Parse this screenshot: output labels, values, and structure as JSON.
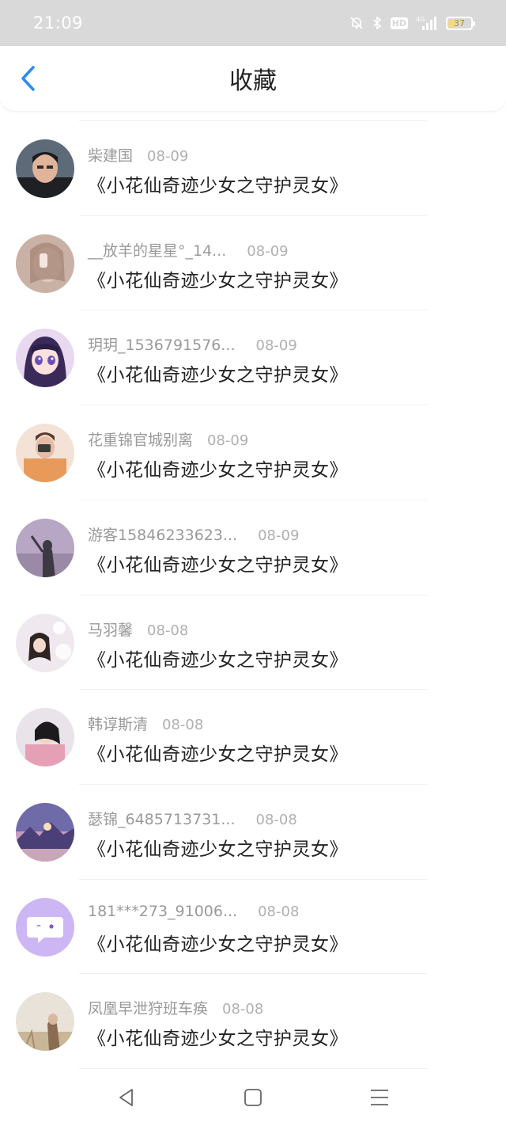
{
  "status_bar": {
    "time": "21:09",
    "network": "4G",
    "battery": "37",
    "battery_level": 0.37
  },
  "header": {
    "title": "收藏",
    "accent_color": "#2a8cf0"
  },
  "favorites": [
    {
      "user": "柴建国",
      "date": "08-09",
      "book": "《小花仙奇迹少女之守护灵女》",
      "avatar": "boy-photo"
    },
    {
      "user": "__放羊的星星°_14...",
      "date": "08-09",
      "book": "《小花仙奇迹少女之守护灵女》",
      "avatar": "girl-selfie"
    },
    {
      "user": "玥玥_1536791576...",
      "date": "08-09",
      "book": "《小花仙奇迹少女之守护灵女》",
      "avatar": "anime-girl"
    },
    {
      "user": "花重锦官城别离",
      "date": "08-09",
      "book": "《小花仙奇迹少女之守护灵女》",
      "avatar": "girl-camera"
    },
    {
      "user": "游客15846233623...",
      "date": "08-09",
      "book": "《小花仙奇迹少女之守护灵女》",
      "avatar": "sunset-silhouette"
    },
    {
      "user": "马羽馨",
      "date": "08-08",
      "book": "《小花仙奇迹少女之守护灵女》",
      "avatar": "girl-bubbles"
    },
    {
      "user": "韩谆斯清",
      "date": "08-08",
      "book": "《小花仙奇迹少女之守护灵女》",
      "avatar": "girl-pink"
    },
    {
      "user": "瑟锦_6485713731...",
      "date": "08-08",
      "book": "《小花仙奇迹少女之守护灵女》",
      "avatar": "landscape"
    },
    {
      "user": "181***273_91006...",
      "date": "08-08",
      "book": "《小花仙奇迹少女之守护灵女》",
      "avatar": "chat-bubble-default"
    },
    {
      "user": "凤凰早泄狩班车痪",
      "date": "08-08",
      "book": "《小花仙奇迹少女之守护灵女》",
      "avatar": "girl-field"
    }
  ],
  "icons": {
    "back": "chevron-left-icon",
    "nav_back": "triangle-back-icon",
    "nav_home": "square-home-icon",
    "nav_menu": "menu-lines-icon"
  }
}
